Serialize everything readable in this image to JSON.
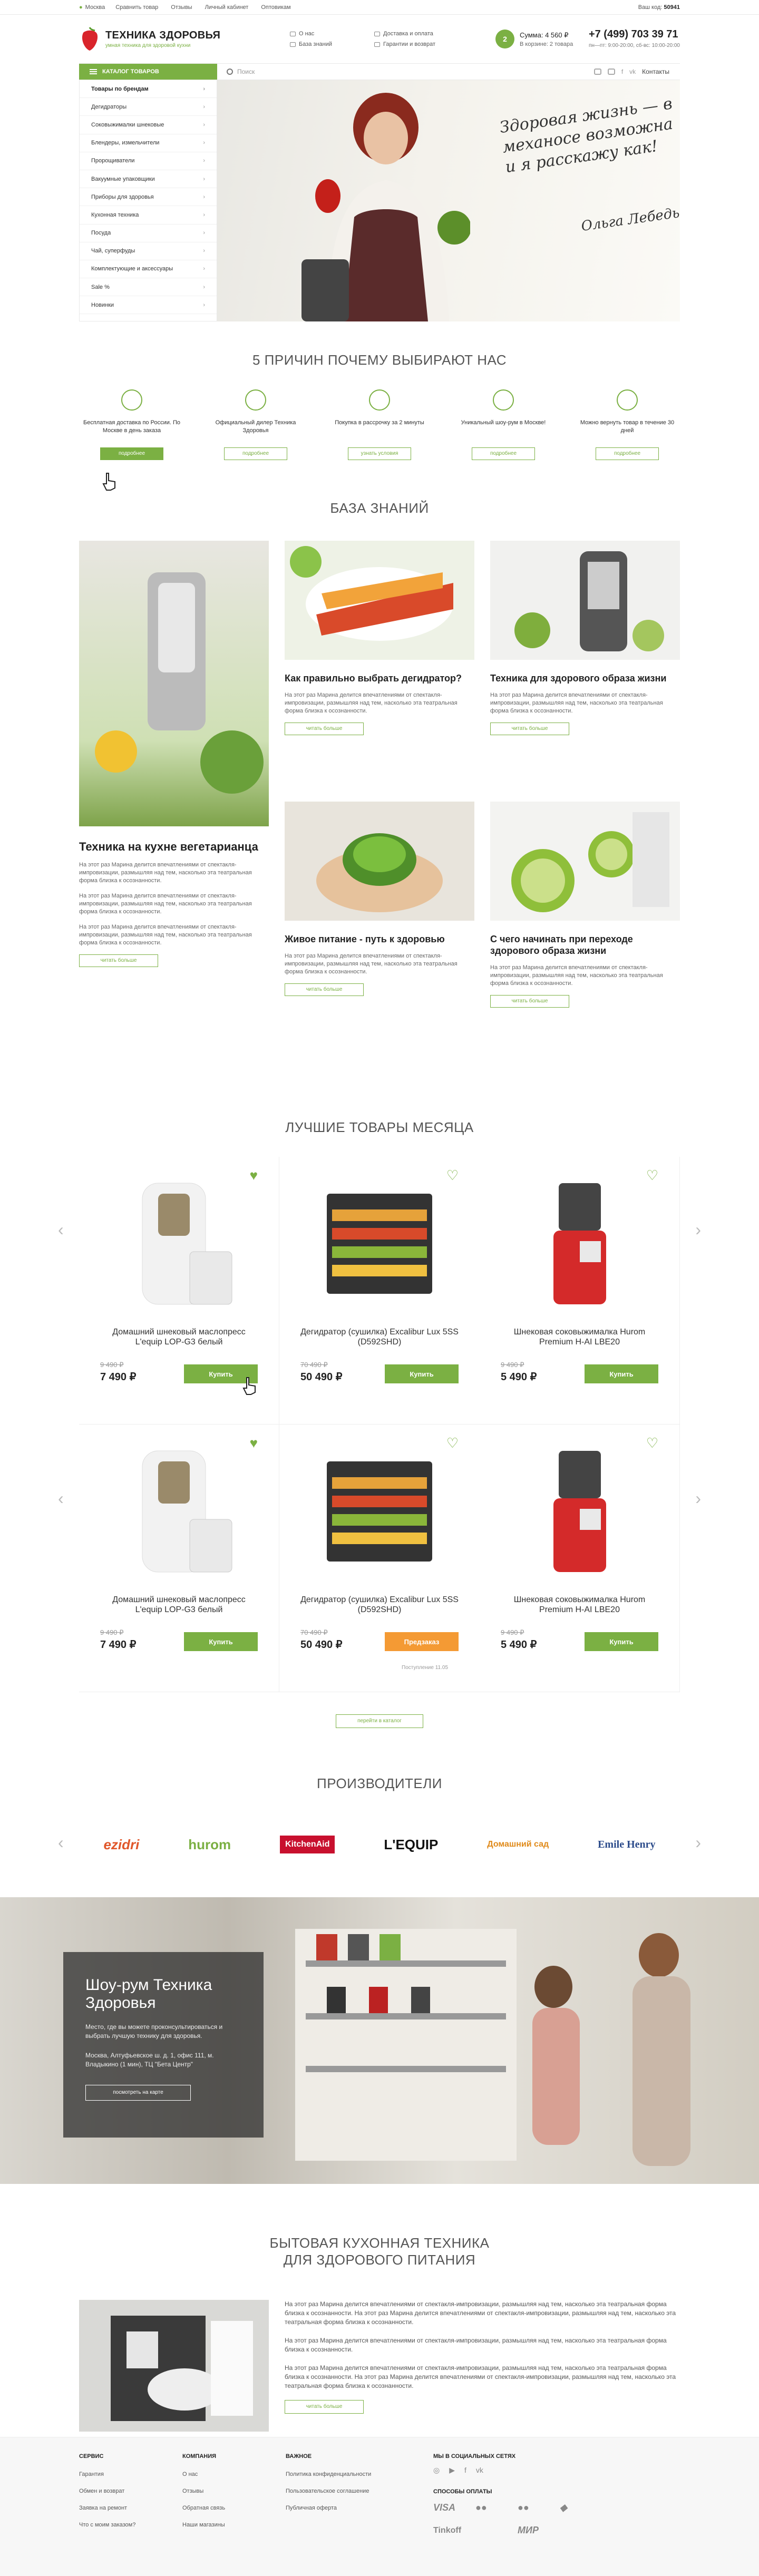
{
  "topbar": {
    "city": "Москва",
    "links": [
      "Сравнить товар",
      "Отзывы",
      "Личный кабинет",
      "Оптовикам"
    ],
    "code_label": "Ваш код:",
    "code": "50941"
  },
  "header": {
    "logo_title": "ТЕХНИКА ЗДОРОВЬЯ",
    "logo_subtitle": "умная техника для здоровой кухни",
    "links": [
      "О нас",
      "Доставка и оплата",
      "База знаний",
      "Гарантии и возврат"
    ],
    "cart_count": "2",
    "cart_sum": "Сумма: 4 560 ₽",
    "cart_items": "В корзине: 2 товара",
    "phone": "+7 (499) 703 39 71",
    "hours": "пн—пт: 9:00-20:00, сб-вс: 10:00-20:00"
  },
  "nav": {
    "catalog_label": "КАТАЛОГ ТОВАРОВ",
    "search_placeholder": "Поиск",
    "contacts": "Контакты"
  },
  "catalog": [
    "Товары по брендам",
    "Дегидраторы",
    "Соковыжималки шнековые",
    "Блендеры, измельчители",
    "Пророщиватели",
    "Вакуумные упаковщики",
    "Приборы для здоровья",
    "Кухонная техника",
    "Посуда",
    "Чай, суперфуды",
    "Комплектующие и аксессуары",
    "Sale %",
    "Новинки"
  ],
  "hero": {
    "quote": "Здоровая жизнь — в механосе возможна и я расскажу как!",
    "signature": "Ольга Лебедь"
  },
  "reasons": {
    "title": "5 ПРИЧИН ПОЧЕМУ ВЫБИРАЮТ НАС",
    "items": [
      {
        "text": "Бесплатная доставка по России. По Москве в день заказа",
        "btn": "подробнее"
      },
      {
        "text": "Официальный дилер Техника Здоровья",
        "btn": "подробнее"
      },
      {
        "text": "Покупка в рассрочку за 2 минуты",
        "btn": "узнать условия"
      },
      {
        "text": "Уникальный шоу-рум в Москве!",
        "btn": "подробнее"
      },
      {
        "text": "Можно вернуть товар в течение 30 дней",
        "btn": "подробнее"
      }
    ]
  },
  "kb": {
    "title": "БАЗА ЗНАНИЙ",
    "big": {
      "title": "Техника на кухне вегетарианца",
      "p1": "На этот раз Марина делится впечатлениями от спектакля-импровизации, размышляя над тем, насколько эта театральная форма близка к осознанности.",
      "p2": "На этот раз Марина делится впечатлениями от спектакля-импровизации, размышляя над тем, насколько эта театральная форма близка к осознанности.",
      "p3": "На этот раз Марина делится впечатлениями от спектакля-импровизации, размышляя над тем, насколько эта театральная форма близка к осознанности.",
      "more": "читать больше"
    },
    "items": [
      {
        "title": "Как правильно выбрать дегидратор?",
        "text": "На этот раз Марина делится впечатлениями от спектакля-импровизации, размышляя над тем, насколько эта театральная форма близка к осознанности.",
        "more": "читать больше"
      },
      {
        "title": "Техника для здорового образа жизни",
        "text": "На этот раз Марина делится впечатлениями от спектакля-импровизации, размышляя над тем, насколько эта театральная форма близка к осознанности.",
        "more": "читать больше"
      },
      {
        "title": "Живое питание - путь к здоровью",
        "text": "На этот раз Марина делится впечатлениями от спектакля-импровизации, размышляя над тем, насколько эта театральная форма близка к осознанности.",
        "more": "читать больше"
      },
      {
        "title": "С чего начинать при переходе здорового образа жизни",
        "text": "На этот раз Марина делится впечатлениями от спектакля-импровизации, размышляя над тем, насколько эта театральная форма близка к осознанности.",
        "more": "читать больше"
      }
    ]
  },
  "best": {
    "title": "ЛУЧШИЕ ТОВАРЫ МЕСЯЦА",
    "items": [
      {
        "name": "Домашний шнековый маслопресс L'equip LOP-G3 белый",
        "old": "9 490 ₽",
        "price": "7 490 ₽",
        "btn": "Купить"
      },
      {
        "name": "Дегидратор (сушилка) Excalibur Lux 5SS (D592SHD)",
        "old": "70 490 ₽",
        "price": "50 490 ₽",
        "btn": "Купить"
      },
      {
        "name": "Шнековая соковыжималка Hurom Premium H-AI LBE20",
        "old": "9 490 ₽",
        "price": "5 490 ₽",
        "btn": "Купить"
      },
      {
        "name": "Домашний шнековый маслопресс L'equip LOP-G3 белый",
        "old": "9 490 ₽",
        "price": "7 490 ₽",
        "btn": "Купить"
      },
      {
        "name": "Дегидратор (сушилка) Excalibur Lux 5SS (D592SHD)",
        "old": "70 490 ₽",
        "price": "50 490 ₽",
        "btn": "Предзаказ",
        "note": "Поступление 11.05"
      },
      {
        "name": "Шнековая соковыжималка Hurom Premium H-AI LBE20",
        "old": "9 490 ₽",
        "price": "5 490 ₽",
        "btn": "Купить"
      }
    ],
    "catalog_btn": "перейти в каталог"
  },
  "brands": {
    "title": "ПРОИЗВОДИТЕЛИ",
    "items": [
      "ezidri",
      "hurom",
      "KitchenAid",
      "L'EQUIP",
      "Домашний сад",
      "Emile Henry"
    ]
  },
  "showroom": {
    "title": "Шоу-рум Техника Здоровья",
    "text": "Место, где вы можете проконсультироваться и выбрать лучшую технику для здоровья.",
    "address": "Москва, Алтуфьевское ш. д. 1, офис 111, м. Владыкино (1 мин), ТЦ \"Бета Центр\"",
    "btn": "посмотреть на карте"
  },
  "appliances": {
    "title1": "БЫТОВАЯ КУХОННАЯ ТЕХНИКА",
    "title2": "ДЛЯ ЗДОРОВОГО ПИТАНИЯ",
    "paras": [
      "На этот раз Марина делится впечатлениями от спектакля-импровизации, размышляя над тем, насколько эта театральная форма близка к осознанности. На этот раз Марина делится впечатлениями от спектакля-импровизации, размышляя над тем, насколько эта театральная форма близка к осознанности.",
      "На этот раз Марина делится впечатлениями от спектакля-импровизации, размышляя над тем, насколько эта театральная форма близка к осознанности.",
      "На этот раз Марина делится впечатлениями от спектакля-импровизации, размышляя над тем, насколько эта театральная форма близка к осознанности. На этот раз Марина делится впечатлениями от спектакля-импровизации, размышляя над тем, насколько эта театральная форма близка к осознанности."
    ],
    "more": "читать больше"
  },
  "footer": {
    "service": {
      "title": "СЕРВИС",
      "items": [
        "Гарантия",
        "Обмен и возврат",
        "Заявка на ремонт",
        "Что с моим заказом?"
      ]
    },
    "company": {
      "title": "КОМПАНИЯ",
      "items": [
        "О нас",
        "Отзывы",
        "Обратная связь",
        "Наши магазины"
      ]
    },
    "important": {
      "title": "ВАЖНОЕ",
      "items": [
        "Политика конфиденциальности",
        "Пользовательское соглашение",
        "Публичная оферта"
      ]
    },
    "social_title": "МЫ В СОЦИАЛЬНЫХ СЕТЯХ",
    "pay_title": "СПОСОБЫ ОПЛАТЫ",
    "pays": [
      "VISA",
      "Tinkoff",
      "МИР"
    ]
  },
  "colors": {
    "accent": "#7bb043",
    "orange": "#f49a34"
  }
}
